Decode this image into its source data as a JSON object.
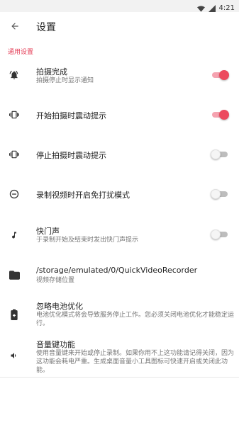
{
  "status_bar": {
    "time": "4:21",
    "icons": [
      "wifi-icon",
      "signal-icon"
    ]
  },
  "app_bar": {
    "title": "设置",
    "back_icon": "arrow-back-icon"
  },
  "section": {
    "title": "通用设置",
    "accent_color": "#e5415a"
  },
  "settings": [
    {
      "icon": "bell-icon",
      "title": "拍摄完成",
      "subtitle": "拍摄停止时显示通知",
      "toggle": true
    },
    {
      "icon": "vibrate-icon",
      "title": "开始拍摄时震动提示",
      "toggle": true
    },
    {
      "icon": "vibrate-icon",
      "title": "停止拍摄时震动提示",
      "toggle": false
    },
    {
      "icon": "do-not-disturb-icon",
      "title": "录制视频时开启免打扰模式",
      "toggle": false
    },
    {
      "icon": "music-note-icon",
      "title": "快门声",
      "subtitle": "于录制开始及结束时发出快门声提示",
      "toggle": false
    },
    {
      "icon": "folder-icon",
      "title": "/storage/emulated/0/QuickVideoRecorder",
      "subtitle": "视频存储位置"
    },
    {
      "icon": "battery-plus-icon",
      "title": "忽略电池优化",
      "subtitle": "电池优化模式将会导致服务停止工作。您必须关闭电池优化才能稳定运行。"
    },
    {
      "icon": "volume-icon",
      "title": "音量键功能",
      "subtitle": "使用音量键来开始或停止录制。如果你用不上这功能请记得关闭，因为这功能会耗电严重。生成桌面音量小工具图标可快速开启或关闭此功能。"
    }
  ]
}
